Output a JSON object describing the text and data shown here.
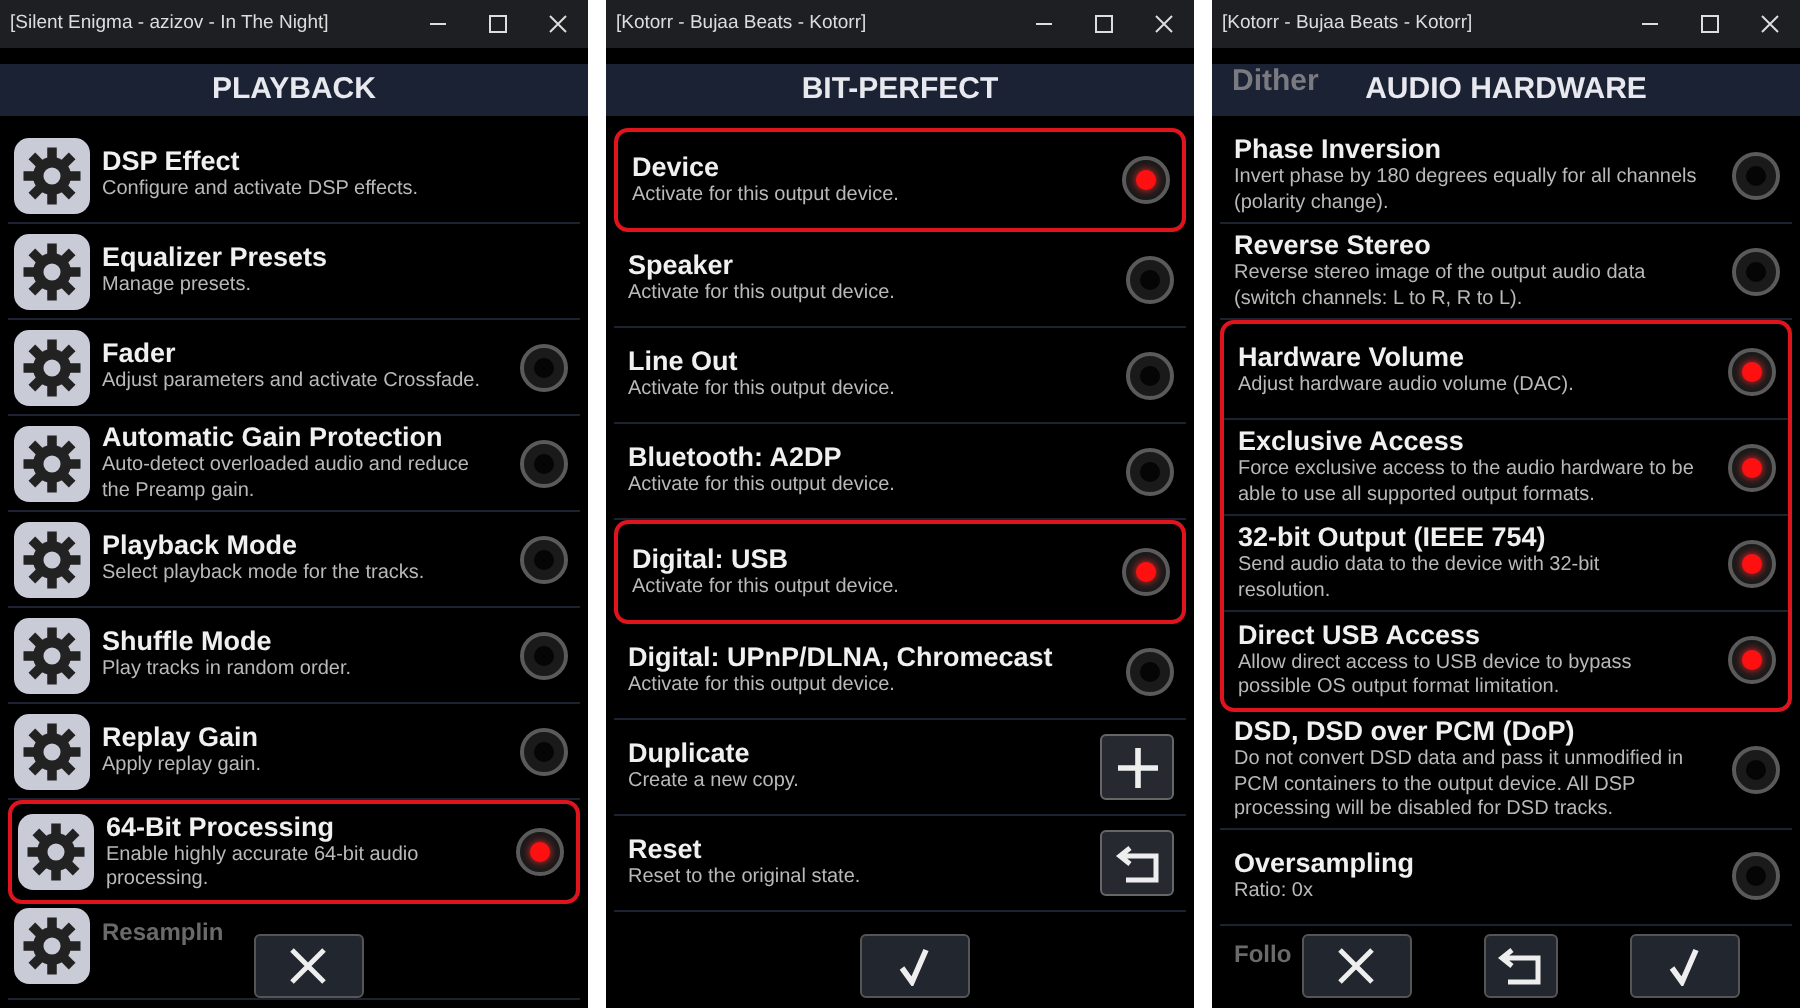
{
  "windows": [
    {
      "title": "[Silent Enigma - azizov - In The Night]",
      "header": "PLAYBACK",
      "kind": "settings",
      "rows": [
        {
          "title": "DSP Effect",
          "desc": "Configure and activate DSP effects.",
          "kind": "none",
          "highlight": false
        },
        {
          "title": "Equalizer Presets",
          "desc": "Manage presets.",
          "kind": "none",
          "highlight": false
        },
        {
          "title": "Fader",
          "desc": "Adjust parameters and activate Crossfade.",
          "kind": "radio",
          "on": false,
          "highlight": false
        },
        {
          "title": "Automatic Gain Protection",
          "desc": "Auto-detect overloaded audio and reduce the Preamp gain.",
          "kind": "radio",
          "on": false,
          "highlight": false
        },
        {
          "title": "Playback Mode",
          "desc": "Select playback mode for the tracks.",
          "kind": "radio",
          "on": false,
          "highlight": false
        },
        {
          "title": "Shuffle Mode",
          "desc": "Play tracks in random order.",
          "kind": "radio",
          "on": false,
          "highlight": false
        },
        {
          "title": "Replay Gain",
          "desc": "Apply replay gain.",
          "kind": "radio",
          "on": false,
          "highlight": false
        },
        {
          "title": "64-Bit Processing",
          "desc": "Enable highly accurate 64-bit audio processing.",
          "kind": "radio",
          "on": true,
          "highlight": true
        },
        {
          "title": "Resamplin",
          "kind": "faded",
          "highlight": false
        }
      ],
      "buttons": [
        {
          "kind": "cancel"
        }
      ]
    },
    {
      "title": "[Kotorr - Bujaa Beats - Kotorr]",
      "header": "BIT-PERFECT",
      "kind": "outputs",
      "rows": [
        {
          "title": "Device",
          "desc": "Activate for this output device.",
          "kind": "radio",
          "on": true,
          "highlight": true
        },
        {
          "title": "Speaker",
          "desc": "Activate for this output device.",
          "kind": "radio",
          "on": false,
          "highlight": false
        },
        {
          "title": "Line Out",
          "desc": "Activate for this output device.",
          "kind": "radio",
          "on": false,
          "highlight": false
        },
        {
          "title": "Bluetooth: A2DP",
          "desc": "Activate for this output device.",
          "kind": "radio",
          "on": false,
          "highlight": false
        },
        {
          "title": "Digital: USB",
          "desc": "Activate for this output device.",
          "kind": "radio",
          "on": true,
          "highlight": true
        },
        {
          "title": "Digital: UPnP/DLNA, Chromecast",
          "desc": "Activate for this output device.",
          "kind": "radio",
          "on": false,
          "highlight": false
        },
        {
          "title": "Duplicate",
          "desc": "Create a new copy.",
          "kind": "plus",
          "highlight": false
        },
        {
          "title": "Reset",
          "desc": "Reset to the original state.",
          "kind": "undo",
          "highlight": false
        }
      ],
      "buttons": [
        {
          "kind": "confirm"
        }
      ]
    },
    {
      "title": "[Kotorr - Bujaa Beats - Kotorr]",
      "header": "AUDIO HARDWARE",
      "behind": "Dither",
      "kind": "outputs",
      "rows": [
        {
          "title": "Phase Inversion",
          "desc": "Invert phase by 180 degrees equally for all channels (polarity change).",
          "kind": "radio",
          "on": false,
          "highlight": false
        },
        {
          "title": "Reverse Stereo",
          "desc": "Reverse stereo image of the output audio data (switch channels: L to R, R to L).",
          "kind": "radio",
          "on": false,
          "highlight": false
        },
        {
          "title": "Hardware Volume",
          "desc": "Adjust hardware audio volume (DAC).",
          "kind": "radio",
          "on": true,
          "highlight": true
        },
        {
          "title": "Exclusive Access",
          "desc": "Force exclusive access to the audio hardware to be able to use all supported output formats.",
          "kind": "radio",
          "on": true,
          "highlight": true
        },
        {
          "title": "32-bit Output (IEEE 754)",
          "desc": "Send audio data to the device with 32-bit resolution.",
          "kind": "radio",
          "on": true,
          "highlight": true
        },
        {
          "title": "Direct USB Access",
          "desc": "Allow direct access to USB device to bypass possible OS output format limitation.",
          "kind": "radio",
          "on": true,
          "highlight": true
        },
        {
          "title": "DSD, DSD over PCM (DoP)",
          "desc": "Do not convert DSD data and pass it unmodified in PCM containers to the output device. All DSP processing will be disabled for DSD tracks.",
          "kind": "radio",
          "on": false,
          "highlight": false
        },
        {
          "title": "Oversampling",
          "desc": "Ratio: 0x",
          "kind": "radio",
          "on": false,
          "highlight": false
        },
        {
          "title": "Follo",
          "kind": "faded",
          "highlight": false
        }
      ],
      "buttons": [
        {
          "kind": "cancel"
        },
        {
          "kind": "undo"
        },
        {
          "kind": "confirm"
        }
      ]
    }
  ]
}
